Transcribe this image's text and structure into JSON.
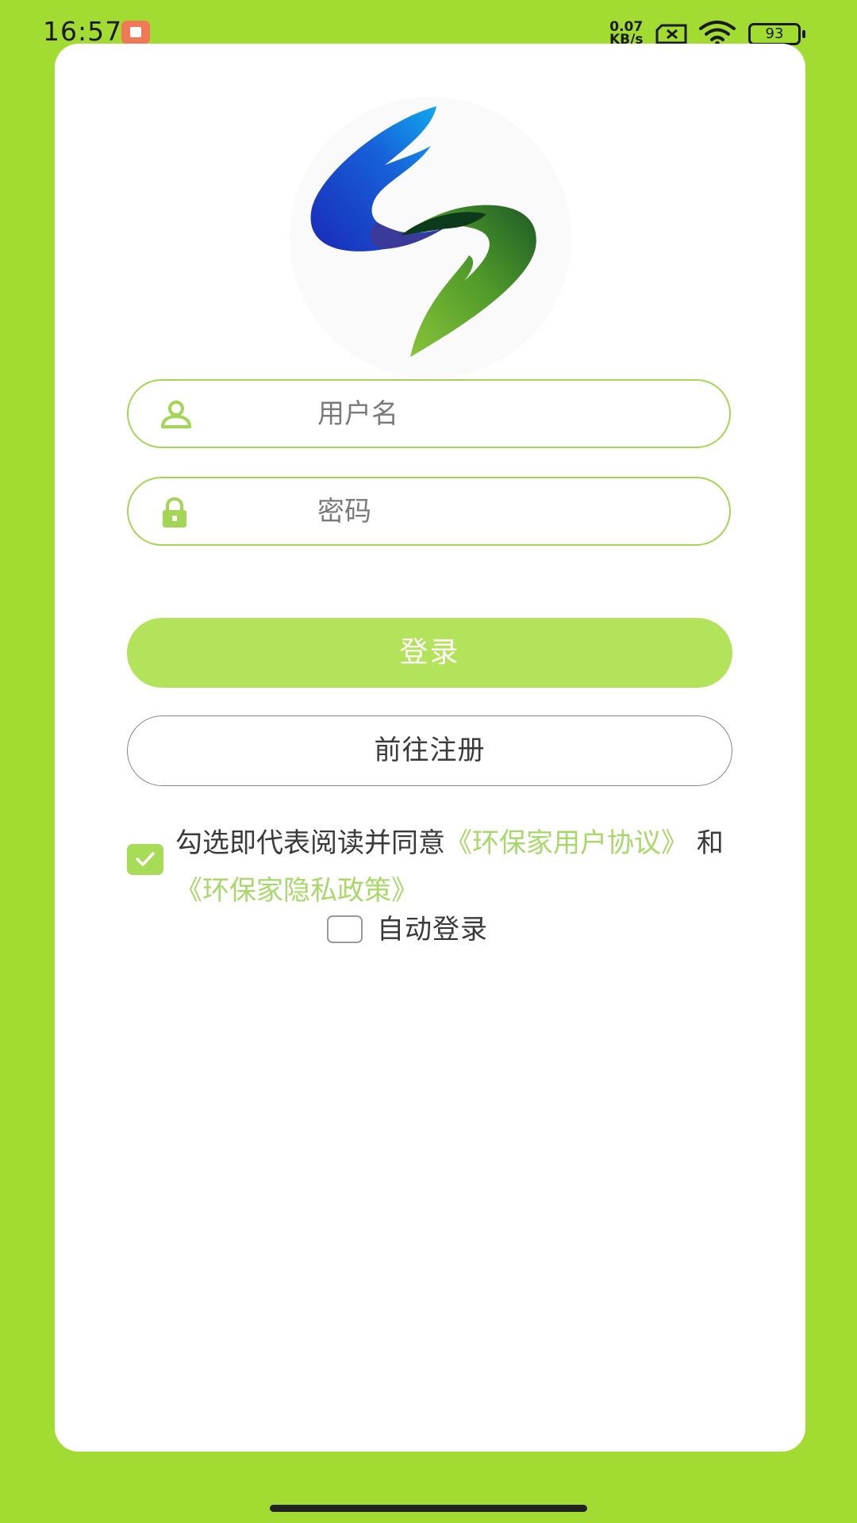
{
  "status_bar": {
    "time": "16:57",
    "net_speed_value": "0.07",
    "net_speed_unit": "KB/s",
    "battery": "93",
    "icons": [
      "app-notification-icon",
      "sim-error-icon",
      "wifi-icon",
      "battery-icon"
    ]
  },
  "login_form": {
    "username_placeholder": "用户名",
    "password_placeholder": "密码",
    "login_button": "登录",
    "register_button": "前往注册"
  },
  "agreement": {
    "checked": true,
    "prefix": "勾选即代表阅读并同意",
    "user_agreement_link": "《环保家用户协议》",
    "conjunction": "和",
    "privacy_policy_link": "《环保家隐私政策》"
  },
  "auto_login": {
    "checked": false,
    "label": "自动登录"
  },
  "colors": {
    "background": "#a2dc32",
    "accent": "#a3d654",
    "login_button": "#b3e35b",
    "link": "#a9d86a"
  }
}
